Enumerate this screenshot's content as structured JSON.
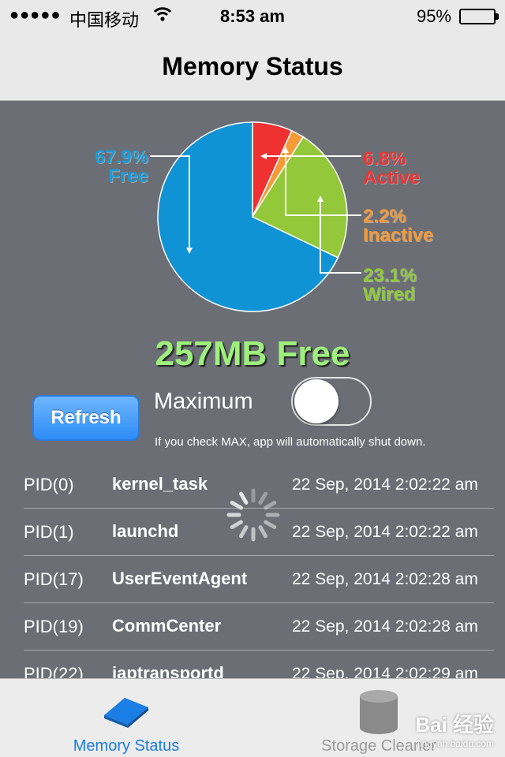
{
  "status_bar": {
    "signal": "●●●●●",
    "carrier": "中国移动",
    "wifi_icon": "wifi-icon",
    "time": "8:53 am",
    "battery": "95%"
  },
  "nav": {
    "title": "Memory Status"
  },
  "pie": {
    "colors": {
      "free": "#0f93d4",
      "active": "#f03131",
      "inactive": "#f59a36",
      "wired": "#93c83a"
    },
    "free": {
      "percent": "67.9%",
      "label": "Free",
      "value": 67.9
    },
    "active": {
      "percent": "6.8%",
      "label": "Active",
      "value": 6.8
    },
    "inactive": {
      "percent": "2.2%",
      "label": "Inactive",
      "value": 2.2
    },
    "wired": {
      "percent": "23.1%",
      "label": "Wired",
      "value": 23.1
    }
  },
  "free_memory": "257MB Free",
  "controls": {
    "refresh_label": "Refresh",
    "maximum_label": "Maximum",
    "maximum_on": false,
    "note": "If you check MAX, app will automatically shut down."
  },
  "processes": [
    {
      "pid": "PID(0)",
      "name": "kernel_task",
      "date": "22 Sep, 2014 2:02:22 am"
    },
    {
      "pid": "PID(1)",
      "name": "launchd",
      "date": "22 Sep, 2014 2:02:22 am"
    },
    {
      "pid": "PID(17)",
      "name": "UserEventAgent",
      "date": "22 Sep, 2014 2:02:28 am"
    },
    {
      "pid": "PID(19)",
      "name": "CommCenter",
      "date": "22 Sep, 2014 2:02:28 am"
    },
    {
      "pid": "PID(22)",
      "name": "iaptransportd",
      "date": "22 Sep, 2014 2:02:29 am"
    }
  ],
  "tabs": [
    {
      "label": "Memory Status",
      "icon": "memory-chip-icon",
      "selected": true
    },
    {
      "label": "Storage Cleaner",
      "icon": "database-icon",
      "selected": false
    }
  ],
  "watermark": {
    "text": "Bai 经验",
    "sub": "jingyan.baidu.com"
  }
}
